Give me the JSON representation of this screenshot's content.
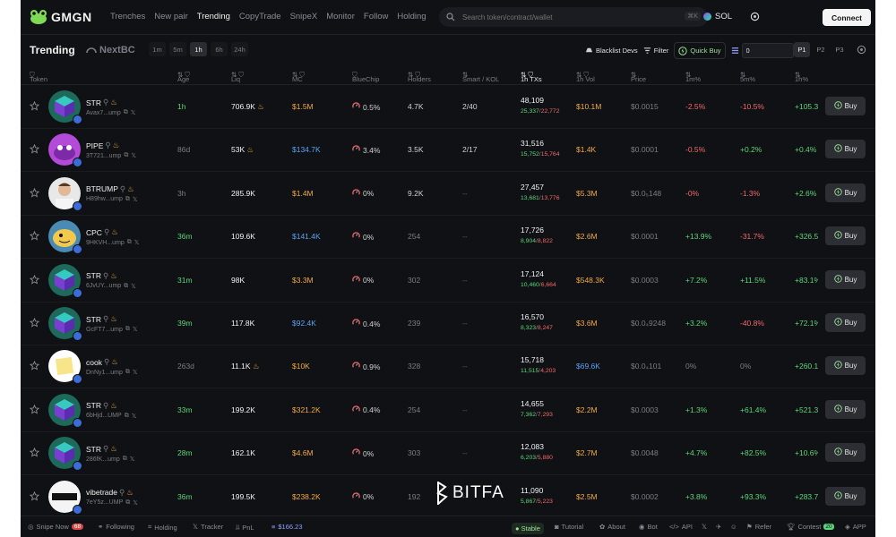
{
  "brand": {
    "name": "GMGN"
  },
  "nav": {
    "links": [
      "Trenches",
      "New pair",
      "Trending",
      "CopyTrade",
      "SnipeX",
      "Monitor",
      "Follow",
      "Holding"
    ],
    "active": "Trending"
  },
  "search": {
    "placeholder": "Search token/contract/wallet",
    "shortcut": "⌘K"
  },
  "chain": {
    "label": "SOL"
  },
  "connect_label": "Connect",
  "toolbar": {
    "title": "Trending",
    "next_label": "NextBC",
    "timeframes": [
      "1m",
      "5m",
      "1h",
      "6h",
      "24h"
    ],
    "active_timeframe": "1h",
    "blacklist_label": "Blacklist Devs",
    "filter_label": "Filter",
    "quickbuy_label": "Quick Buy",
    "quickbuy_value": "0",
    "pages": [
      "P1",
      "P2",
      "P3"
    ],
    "active_page": "P1"
  },
  "headers": {
    "token": "Token",
    "age": "Age",
    "liq": "Liq",
    "mc": "MC",
    "bluechip": "BlueChip",
    "holders": "Holders",
    "smart": "Smart / KOL",
    "txs": "1h TXs",
    "vol": "1h Vol",
    "price": "Price",
    "m1": "1m%",
    "m5": "5m%",
    "h1": "1h%"
  },
  "buy_label": "Buy",
  "rows": [
    {
      "symbol": "STR",
      "addr": "Avax7...ump",
      "age": "1h",
      "liq": "706.9K",
      "hot": true,
      "mc": "$1.5M",
      "mc_color": "orange",
      "bluechip": "0.5%",
      "holders": "4.7K",
      "smart": "2/40",
      "txs": "48,109",
      "buys": "25,337",
      "sells": "22,772",
      "vol": "$10.1M",
      "vol_color": "orange",
      "price": "$0.0015",
      "m1": "-2.5%",
      "m1c": "red",
      "m5": "-10.5%",
      "m5c": "red",
      "h1": "+105.3%",
      "h1c": "green",
      "avatar": "cube"
    },
    {
      "symbol": "PIPE",
      "addr": "3T721...ump",
      "age": "86d",
      "liq": "53K",
      "hot": true,
      "mc": "$134.7K",
      "mc_color": "blue",
      "bluechip": "3.4%",
      "holders": "3.5K",
      "smart": "2/17",
      "txs": "31,516",
      "buys": "15,752",
      "sells": "15,764",
      "vol": "$1.4K",
      "vol_color": "orange",
      "price": "$0.0001",
      "m1": "-0.5%",
      "m1c": "red",
      "m5": "+0.2%",
      "m5c": "green",
      "h1": "+0.4%",
      "h1c": "green",
      "avatar": "pipe"
    },
    {
      "symbol": "BTRUMP",
      "addr": "H89hw...ump",
      "age": "3h",
      "liq": "285.9K",
      "hot": false,
      "mc": "$1.4M",
      "mc_color": "orange",
      "bluechip": "0%",
      "holders": "9.2K",
      "smart": "--",
      "txs": "27,457",
      "buys": "13,681",
      "sells": "13,776",
      "vol": "$5.3M",
      "vol_color": "orange",
      "price": "$0.0₅148",
      "m1": "-0%",
      "m1c": "red",
      "m5": "-1.3%",
      "m5c": "red",
      "h1": "+2.6%",
      "h1c": "green",
      "avatar": "person"
    },
    {
      "symbol": "CPC",
      "addr": "9HKVH...ump",
      "age": "36m",
      "liq": "109.6K",
      "hot": false,
      "mc": "$141.4K",
      "mc_color": "blue",
      "bluechip": "0%",
      "holders": "254",
      "smart": "--",
      "txs": "17,726",
      "buys": "8,904",
      "sells": "8,822",
      "vol": "$2.6M",
      "vol_color": "orange",
      "price": "$0.0001",
      "m1": "+13.9%",
      "m1c": "green",
      "m5": "-31.7%",
      "m5c": "red",
      "h1": "+326.5%",
      "h1c": "green",
      "avatar": "cpc"
    },
    {
      "symbol": "STR",
      "addr": "6JvUY...ump",
      "age": "31m",
      "liq": "98K",
      "hot": false,
      "mc": "$3.3M",
      "mc_color": "orange",
      "bluechip": "0%",
      "holders": "302",
      "smart": "--",
      "txs": "17,124",
      "buys": "10,460",
      "sells": "6,664",
      "vol": "$548.3K",
      "vol_color": "orange",
      "price": "$0.0003",
      "m1": "+7.2%",
      "m1c": "green",
      "m5": "+11.5%",
      "m5c": "green",
      "h1": "+83.1%",
      "h1c": "green",
      "avatar": "cube"
    },
    {
      "symbol": "STR",
      "addr": "GcFT7...ump",
      "age": "39m",
      "liq": "117.8K",
      "hot": false,
      "mc": "$92.4K",
      "mc_color": "blue",
      "bluechip": "0.4%",
      "holders": "239",
      "smart": "--",
      "txs": "16,570",
      "buys": "8,323",
      "sells": "8,247",
      "vol": "$3.6M",
      "vol_color": "orange",
      "price": "$0.0₄9248",
      "m1": "+3.2%",
      "m1c": "green",
      "m5": "-40.8%",
      "m5c": "red",
      "h1": "+72.1%",
      "h1c": "green",
      "avatar": "cube"
    },
    {
      "symbol": "cook",
      "addr": "DnNy1...ump",
      "age": "263d",
      "liq": "11.1K",
      "hot": true,
      "mc": "$10K",
      "mc_color": "orange",
      "bluechip": "0.9%",
      "holders": "328",
      "smart": "--",
      "txs": "15,718",
      "buys": "11,515",
      "sells": "4,203",
      "vol": "$69.6K",
      "vol_color": "blue",
      "price": "$0.0₄101",
      "m1": "0%",
      "m1c": "gray",
      "m5": "0%",
      "m5c": "gray",
      "h1": "+260.1%",
      "h1c": "green",
      "avatar": "note"
    },
    {
      "symbol": "STR",
      "addr": "6bHjd...UMP",
      "age": "33m",
      "liq": "199.2K",
      "hot": false,
      "mc": "$321.2K",
      "mc_color": "orange",
      "bluechip": "0.4%",
      "holders": "254",
      "smart": "--",
      "txs": "14,655",
      "buys": "7,362",
      "sells": "7,293",
      "vol": "$2.2M",
      "vol_color": "orange",
      "price": "$0.0003",
      "m1": "+1.3%",
      "m1c": "green",
      "m5": "+61.4%",
      "m5c": "green",
      "h1": "+521.3%",
      "h1c": "green",
      "avatar": "cube"
    },
    {
      "symbol": "STR",
      "addr": "286fK...ump",
      "age": "28m",
      "liq": "162.1K",
      "hot": false,
      "mc": "$4.6M",
      "mc_color": "orange",
      "bluechip": "0%",
      "holders": "303",
      "smart": "--",
      "txs": "12,083",
      "buys": "6,203",
      "sells": "5,880",
      "vol": "$2.7M",
      "vol_color": "orange",
      "price": "$0.0048",
      "m1": "+4.7%",
      "m1c": "green",
      "m5": "+82.5%",
      "m5c": "green",
      "h1": "+10.6%",
      "h1c": "green",
      "avatar": "cube"
    },
    {
      "symbol": "vibetrade",
      "addr": "7eY5z...UMP",
      "age": "36m",
      "liq": "199.5K",
      "hot": false,
      "mc": "$238.2K",
      "mc_color": "orange",
      "bluechip": "0%",
      "holders": "192",
      "smart": "--",
      "txs": "11,090",
      "buys": "5,867",
      "sells": "5,223",
      "vol": "$2.5M",
      "vol_color": "orange",
      "price": "$0.0002",
      "m1": "+3.8%",
      "m1c": "green",
      "m5": "+93.3%",
      "m5c": "green",
      "h1": "+283.7%",
      "h1c": "green",
      "avatar": "vibe"
    }
  ],
  "footer": {
    "snipe_label": "Snipe Now",
    "snipe_badge": "68",
    "following": "Following",
    "holding": "Holding",
    "tracker": "Tracker",
    "pnl": "PnL",
    "balance": "$166.23",
    "stable": "Stable",
    "tutorial": "Tutorial",
    "about": "About",
    "bot": "Bot",
    "api": "API",
    "refer": "Refer",
    "contest": "Contest",
    "contest_badge": "20",
    "app": "APP"
  },
  "watermark": "BITFA",
  "colors": {
    "background": "#101114",
    "green": "#5bd67a",
    "red": "#f06a6a",
    "orange": "#f0a948",
    "blue": "#5aa2f0"
  }
}
